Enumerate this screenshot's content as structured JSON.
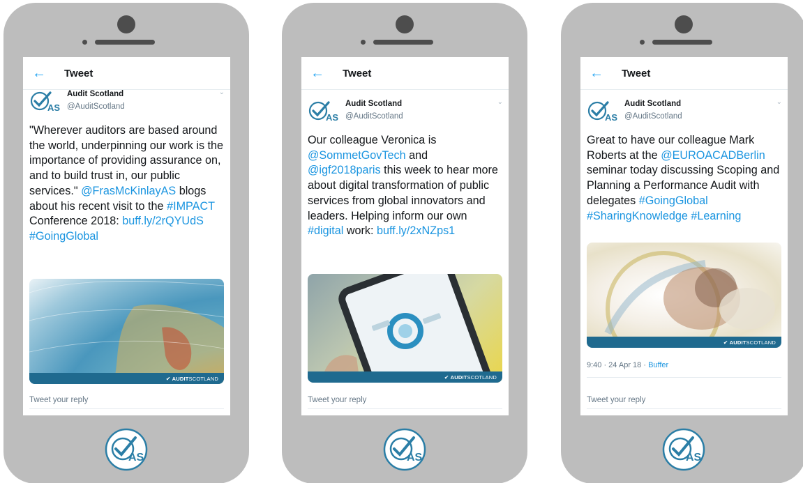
{
  "phones": [
    {
      "header": {
        "back_icon": "arrow-left-icon",
        "title": "Tweet"
      },
      "account": {
        "name": "Audit Scotland",
        "handle": "@AuditScotland",
        "avatar_text": "AS"
      },
      "tweet": {
        "p1": "\"Wherever auditors are based around the world, underpinning our work is the importance of providing assurance on, and to build trust in, our public services.\"",
        "mention": "@FrasMcKinlayAS",
        "p2": "blogs about his recent visit to the",
        "hashtag_impact": "#IMPACT",
        "p3": "Conference 2018:",
        "link": "buff.ly/2rQYUdS",
        "hashtag_going": "#GoingGlobal"
      },
      "media": {
        "brand_mark": "AUDIT",
        "brand_rest": "SCOTLAND"
      },
      "reply_placeholder": "Tweet your reply"
    },
    {
      "header": {
        "back_icon": "arrow-left-icon",
        "title": "Tweet"
      },
      "account": {
        "name": "Audit Scotland",
        "handle": "@AuditScotland",
        "avatar_text": "AS"
      },
      "tweet": {
        "p1": "Our colleague Veronica is",
        "mention1": "@SommetGovTech",
        "p2": "and",
        "mention2": "@igf2018paris",
        "p3": "this week to hear more about digital transformation of public services from global innovators and leaders. Helping inform our own",
        "hashtag": "#digital",
        "p4": "work:",
        "link": "buff.ly/2xNZps1"
      },
      "media": {
        "brand_mark": "AUDIT",
        "brand_rest": "SCOTLAND"
      },
      "reply_placeholder": "Tweet your reply"
    },
    {
      "header": {
        "back_icon": "arrow-left-icon",
        "title": "Tweet"
      },
      "account": {
        "name": "Audit Scotland",
        "handle": "@AuditScotland",
        "avatar_text": "AS"
      },
      "tweet": {
        "p1": "Great to have our colleague Mark Roberts at the",
        "mention": "@EUROACADBerlin",
        "p2": "seminar today discussing Scoping and Planning a Performance Audit with delegates",
        "hashtag1": "#GoingGlobal",
        "hashtag2": "#SharingKnowledge",
        "hashtag3": "#Learning"
      },
      "media": {
        "brand_mark": "AUDIT",
        "brand_rest": "SCOTLAND"
      },
      "meta": {
        "time": "9:40 · 24 Apr 18 ·",
        "source": "Buffer"
      },
      "reply_placeholder": "Tweet your reply"
    }
  ],
  "home_logo_text": "AS",
  "colors": {
    "link": "#1b95e0",
    "brand_bar": "#1f6a8f",
    "phone_body": "#bdbdbd",
    "logo_blue": "#2b7ea6"
  }
}
